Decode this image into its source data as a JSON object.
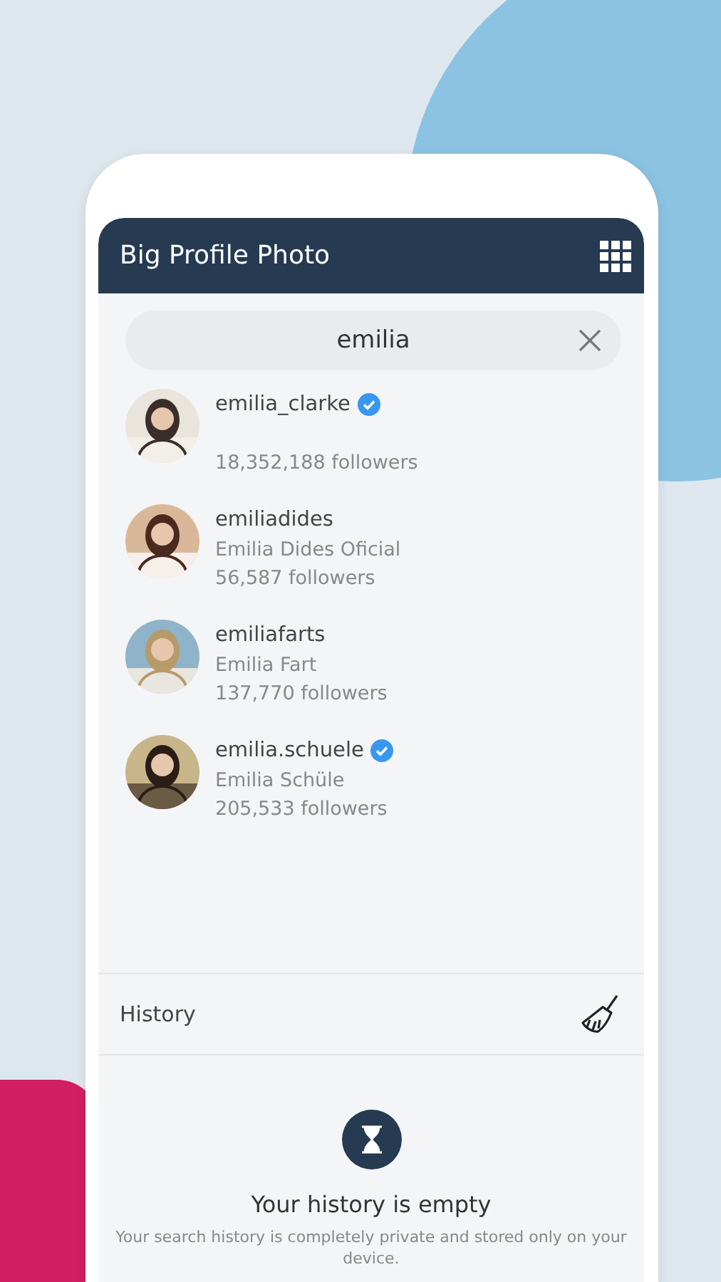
{
  "app_bar": {
    "title": "Big Profile Photo"
  },
  "search": {
    "value": "emilia"
  },
  "results": [
    {
      "username": "emilia_clarke",
      "verified": true,
      "followers": "18,352,188 followers"
    },
    {
      "username": "emiliadides",
      "verified": false,
      "full_name": "Emilia Dides Oficial",
      "followers": "56,587 followers"
    },
    {
      "username": "emiliafarts",
      "verified": false,
      "full_name": "Emilia Fart",
      "followers": "137,770 followers"
    },
    {
      "username": "emilia.schuele",
      "verified": true,
      "full_name": "Emilia Schüle",
      "followers": "205,533 followers"
    }
  ],
  "history": {
    "label": "History",
    "empty_title": "Your history is empty",
    "empty_text": "Your search history is completely private and stored only on your device."
  }
}
